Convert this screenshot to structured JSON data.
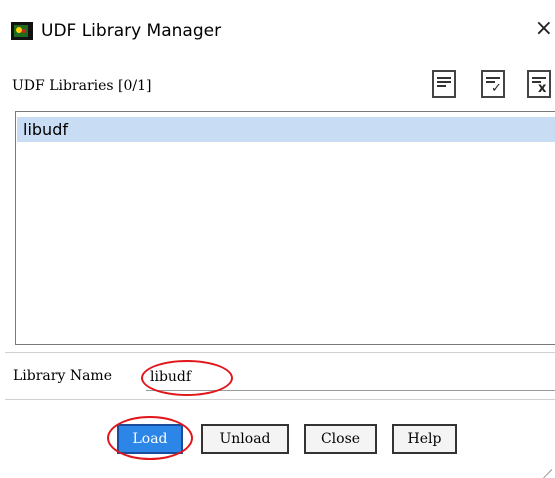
{
  "window": {
    "title": "UDF Library Manager",
    "close_glyph": "×",
    "icon": "fluent-app-icon"
  },
  "libraries": {
    "label": "UDF Libraries [0/1]",
    "items": [
      "libudf"
    ],
    "toolbar": [
      {
        "icon": "select-all-icon"
      },
      {
        "icon": "select-check-icon"
      },
      {
        "icon": "deselect-icon"
      }
    ]
  },
  "library_name": {
    "label": "Library Name",
    "value": "libudf"
  },
  "buttons": {
    "load": "Load",
    "unload": "Unload",
    "close": "Close",
    "help": "Help"
  },
  "colors": {
    "selection": "#c8ddf3",
    "primary_button": "#2b86e8",
    "annotation": "#e0161a"
  }
}
